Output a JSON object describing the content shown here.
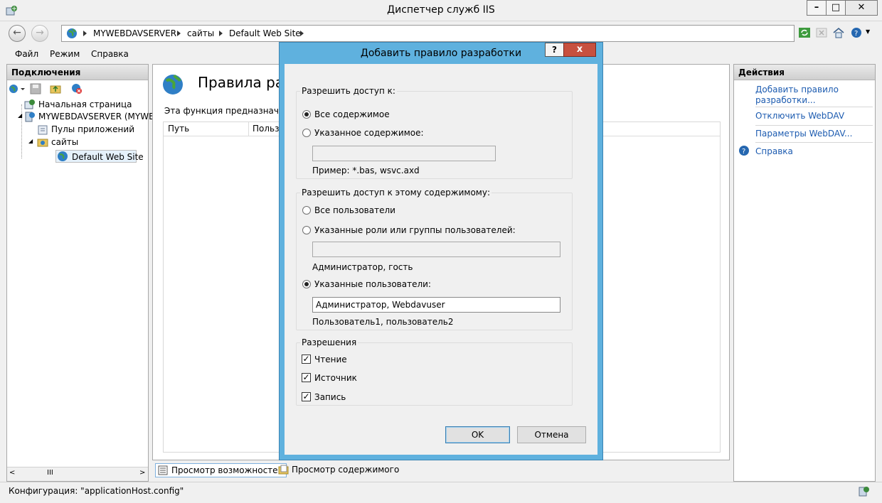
{
  "window": {
    "title": "Диспетчер служб IIS"
  },
  "address": {
    "crumbs": [
      "MYWEBDAVSERVER",
      "сайты",
      "Default Web Site"
    ]
  },
  "menu": {
    "items": [
      "Файл",
      "Режим",
      "Справка"
    ]
  },
  "connections": {
    "header": "Подключения",
    "tree": [
      "Начальная страница",
      "MYWEBDAVSERVER (MYWEBD",
      "Пулы приложений",
      "сайты",
      "Default Web Site"
    ],
    "scroll_mid": "III"
  },
  "center": {
    "title": "Правила разр",
    "description": "Эта функция предназначена д",
    "columns": [
      "Путь",
      "Пользо"
    ],
    "view_tabs": [
      "Просмотр возможностей",
      "Просмотр содержимого"
    ]
  },
  "actions": {
    "header": "Действия",
    "links": [
      "Добавить правило разработки...",
      "Отключить WebDAV",
      "Параметры WebDAV..."
    ],
    "help": "Справка"
  },
  "status": {
    "text": "Конфигурация: \"applicationHost.config\""
  },
  "dialog": {
    "title": "Добавить правило разработки",
    "help_btn": "?",
    "close_btn": "x",
    "access_group": {
      "title": "Разрешить доступ к:",
      "all_content": "Все содержимое",
      "specified_content": "Указанное содержимое:",
      "content_value": "",
      "example": "Пример: *.bas, wsvc.axd",
      "selected": "all_content"
    },
    "users_group": {
      "title": "Разрешить доступ к этому содержимому:",
      "all_users": "Все пользователи",
      "roles": "Указанные роли или группы пользователей:",
      "roles_value": "",
      "roles_hint": "Администратор, гость",
      "specified_users": "Указанные пользователи:",
      "users_value": "Администратор, Webdavuser",
      "users_hint": "Пользователь1, пользователь2",
      "selected": "specified_users"
    },
    "permissions": {
      "title": "Разрешения",
      "read": "Чтение",
      "source": "Источник",
      "write": "Запись",
      "read_checked": true,
      "source_checked": true,
      "write_checked": true
    },
    "ok": "OK",
    "cancel": "Отмена"
  }
}
